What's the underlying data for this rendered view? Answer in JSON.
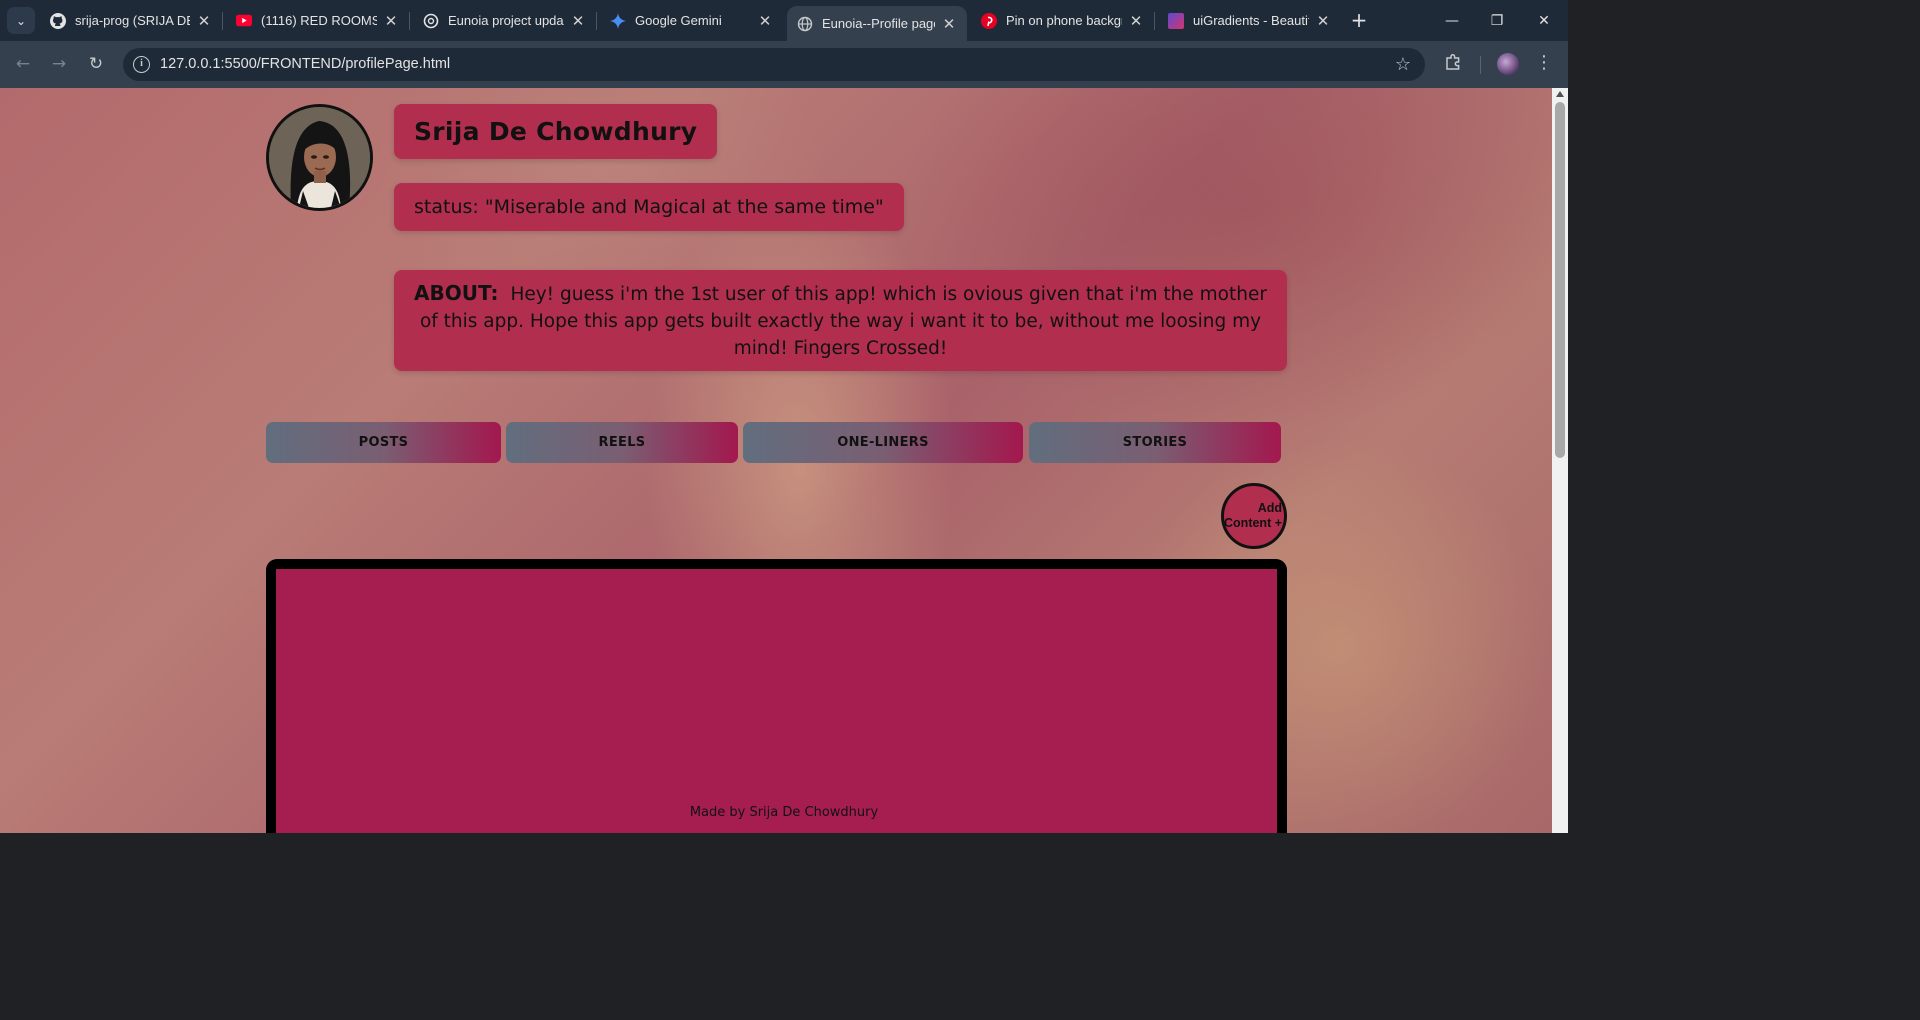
{
  "browser": {
    "tabs": [
      {
        "title": "srija-prog (SRIJA DE C",
        "icon": "github-icon",
        "active": false
      },
      {
        "title": "(1116) RED ROOMS I",
        "icon": "youtube-icon",
        "active": false
      },
      {
        "title": "Eunoia project upda",
        "icon": "openai-icon",
        "active": false
      },
      {
        "title": "Google Gemini",
        "icon": "gemini-icon",
        "active": false
      },
      {
        "title": "Eunoia--Profile page",
        "icon": "globe-icon",
        "active": true
      },
      {
        "title": "Pin on phone backgr",
        "icon": "pinterest-icon",
        "active": false
      },
      {
        "title": "uiGradients - Beautifu",
        "icon": "uigradients-icon",
        "active": false
      }
    ],
    "address": "127.0.0.1:5500/FRONTEND/profilePage.html"
  },
  "profile": {
    "name": "Srija De Chowdhury",
    "status": "status: \"Miserable and Magical at the same time\"",
    "about_label": "ABOUT:",
    "about_text": "Hey! guess i'm the 1st user of this app! which is ovious given that i'm the mother of this app. Hope this app gets built exactly the way i want it to be, without me loosing my mind! Fingers Crossed!"
  },
  "content_tabs": [
    {
      "label": "POSTS"
    },
    {
      "label": "REELS"
    },
    {
      "label": "ONE-LINERS"
    },
    {
      "label": "STORIES"
    }
  ],
  "add_content": {
    "line1": "Add",
    "line2": "Content +"
  },
  "footer": {
    "text": "Made by Srija De Chowdhury"
  },
  "colors": {
    "card": "#b22e4e",
    "content_panel": "#a61e4f",
    "tab_gradient_start": "#616e7e",
    "tab_gradient_end": "#a3184e"
  }
}
